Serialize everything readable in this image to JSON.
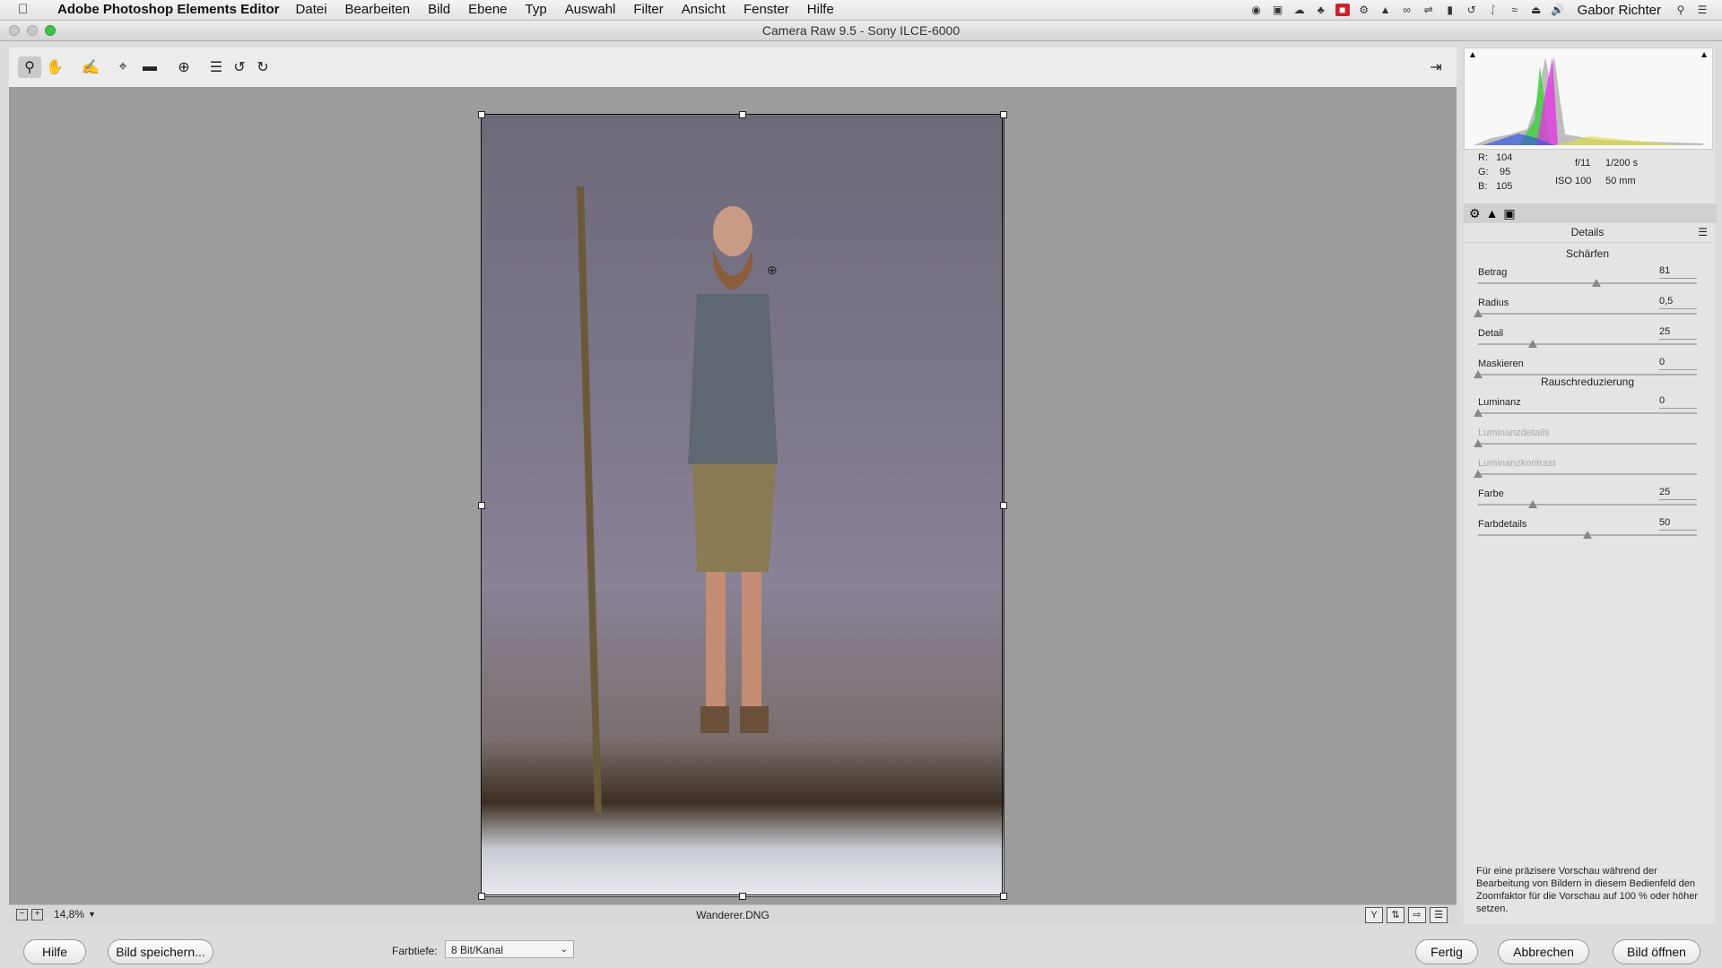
{
  "menubar": {
    "app_name": "Adobe Photoshop Elements Editor",
    "items": [
      "Datei",
      "Bearbeiten",
      "Bild",
      "Ebene",
      "Typ",
      "Auswahl",
      "Filter",
      "Ansicht",
      "Fenster",
      "Hilfe"
    ],
    "user": "Gabor Richter"
  },
  "window": {
    "title": "Camera Raw 9.5 - Sony ILCE-6000"
  },
  "preview": {
    "zoom": "14,8%",
    "filename": "Wanderer.DNG"
  },
  "readouts": {
    "r_label": "R:",
    "r_value": "104",
    "g_label": "G:",
    "g_value": "95",
    "b_label": "B:",
    "b_value": "105",
    "aperture": "f/11",
    "shutter": "1/200 s",
    "iso": "ISO 100",
    "focal": "50 mm"
  },
  "panel": {
    "title": "Details",
    "sharpen_title": "Schärfen",
    "noise_title": "Rauschreduzierung",
    "sharpen_sliders": [
      {
        "label": "Betrag",
        "value": "81",
        "fraction": 0.54
      },
      {
        "label": "Radius",
        "value": "0,5",
        "fraction": 0.0
      },
      {
        "label": "Detail",
        "value": "25",
        "fraction": 0.25
      },
      {
        "label": "Maskieren",
        "value": "0",
        "fraction": 0.0
      }
    ],
    "noise_sliders": [
      {
        "label": "Luminanz",
        "value": "0",
        "fraction": 0.0
      },
      {
        "label": "Luminanzdetails",
        "value": "",
        "fraction": 0.0
      },
      {
        "label": "Luminanzkontrast",
        "value": "",
        "fraction": 0.0
      },
      {
        "label": "Farbe",
        "value": "25",
        "fraction": 0.25
      },
      {
        "label": "Farbdetails",
        "value": "50",
        "fraction": 0.5
      }
    ],
    "hint": "Für eine präzisere Vorschau während der Bearbeitung von Bildern in diesem Bedienfeld den Zoomfaktor für die Vorschau auf 100 % oder höher setzen."
  },
  "bottom": {
    "help_label": "Hilfe",
    "save_label": "Bild speichern...",
    "depth_label": "Farbtiefe:",
    "depth_value": "8 Bit/Kanal",
    "done_label": "Fertig",
    "cancel_label": "Abbrechen",
    "open_label": "Bild öffnen"
  },
  "icons": {
    "tools": [
      "zoom-icon",
      "hand-icon",
      "eyedropper-icon",
      "crop-icon",
      "straighten-icon",
      "redeye-icon",
      "presets-icon",
      "rotate-left-icon",
      "rotate-right-icon"
    ]
  }
}
